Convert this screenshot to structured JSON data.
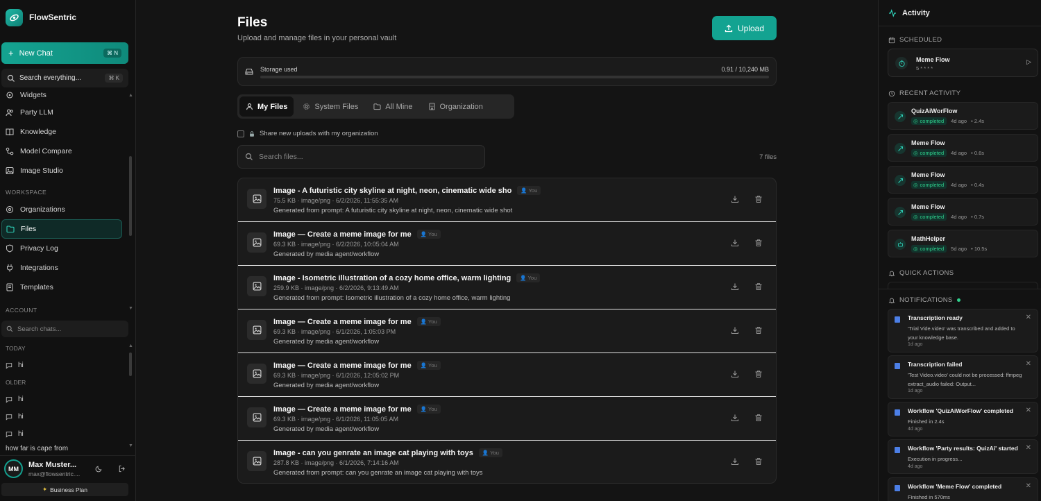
{
  "app": {
    "name": "FlowSentric"
  },
  "sidebar": {
    "new_chat": "New Chat",
    "new_chat_kbd": "⌘ N",
    "search_label": "Search everything...",
    "search_kbd": "⌘ K",
    "items": [
      {
        "label": "Widgets",
        "icon": "widgets-icon"
      },
      {
        "label": "Party LLM",
        "icon": "users-icon"
      },
      {
        "label": "Knowledge",
        "icon": "book-icon"
      },
      {
        "label": "Model Compare",
        "icon": "compare-icon"
      },
      {
        "label": "Image Studio",
        "icon": "image-icon"
      }
    ],
    "workspace_label": "WORKSPACE",
    "workspace_items": [
      {
        "label": "Organizations",
        "icon": "org-icon"
      },
      {
        "label": "Files",
        "icon": "folder-icon"
      },
      {
        "label": "Privacy Log",
        "icon": "shield-icon"
      },
      {
        "label": "Integrations",
        "icon": "plug-icon"
      },
      {
        "label": "Templates",
        "icon": "template-icon"
      }
    ],
    "account_label": "ACCOUNT",
    "chat_search_placeholder": "Search chats...",
    "today_label": "TODAY",
    "today_chats": [
      "hi"
    ],
    "older_label": "OLDER",
    "older_chats": [
      "hi",
      "hi",
      "hi",
      "how far is cape from"
    ],
    "user": {
      "initials": "MM",
      "name": "Max Muster...",
      "email": "max@flowsentric...."
    },
    "plan": "Business Plan"
  },
  "main": {
    "title": "Files",
    "subtitle": "Upload and manage files in your personal vault",
    "upload_label": "Upload",
    "storage_label": "Storage used",
    "storage_value": "0.91 / 10,240 MB",
    "storage_fraction": 0.0001,
    "tabs": [
      {
        "label": "My Files",
        "active": true
      },
      {
        "label": "System Files",
        "active": false
      },
      {
        "label": "All Mine",
        "active": false
      },
      {
        "label": "Organization",
        "active": false
      }
    ],
    "share_label": "Share new uploads with my organization",
    "search_placeholder": "Search files...",
    "file_count": "7 files",
    "you_badge": "You",
    "files": [
      {
        "title": "Image - A futuristic city skyline at night, neon, cinematic wide sho",
        "meta": "75.5 KB · image/png · 6/2/2026, 11:55:35 AM",
        "desc": "Generated from prompt: A futuristic city skyline at night, neon, cinematic wide shot"
      },
      {
        "title": "Image — Create a meme image for me",
        "meta": "69.3 KB · image/png · 6/2/2026, 10:05:04 AM",
        "desc": "Generated by media agent/workflow"
      },
      {
        "title": "Image - Isometric illustration of a cozy home office, warm lighting",
        "meta": "259.9 KB · image/png · 6/2/2026, 9:13:49 AM",
        "desc": "Generated from prompt: Isometric illustration of a cozy home office, warm lighting"
      },
      {
        "title": "Image — Create a meme image for me",
        "meta": "69.3 KB · image/png · 6/1/2026, 1:05:03 PM",
        "desc": "Generated by media agent/workflow"
      },
      {
        "title": "Image — Create a meme image for me",
        "meta": "69.3 KB · image/png · 6/1/2026, 12:05:02 PM",
        "desc": "Generated by media agent/workflow"
      },
      {
        "title": "Image — Create a meme image for me",
        "meta": "69.3 KB · image/png · 6/1/2026, 11:05:05 AM",
        "desc": "Generated by media agent/workflow"
      },
      {
        "title": "Image - can you genrate an image cat playing with toys",
        "meta": "287.8 KB · image/png · 6/1/2026, 7:14:16 AM",
        "desc": "Generated from prompt: can you genrate an image cat playing with toys"
      }
    ]
  },
  "activity": {
    "title": "Activity",
    "scheduled_label": "SCHEDULED",
    "scheduled": {
      "name": "Meme Flow",
      "cron": "5 * * * *"
    },
    "recent_label": "RECENT ACTIVITY",
    "recent": [
      {
        "name": "QuizAiWorFlow",
        "status": "completed",
        "ago": "4d ago",
        "dur": "• 2.4s"
      },
      {
        "name": "Meme Flow",
        "status": "completed",
        "ago": "4d ago",
        "dur": "• 0.6s"
      },
      {
        "name": "Meme Flow",
        "status": "completed",
        "ago": "4d ago",
        "dur": "• 0.4s"
      },
      {
        "name": "Meme Flow",
        "status": "completed",
        "ago": "4d ago",
        "dur": "• 0.7s"
      },
      {
        "name": "MathHelper",
        "status": "completed",
        "ago": "5d ago",
        "dur": "• 10.5s"
      }
    ],
    "quick_label": "QUICK ACTIONS",
    "notifications_label": "NOTIFICATIONS",
    "notifications": [
      {
        "title": "Transcription ready",
        "body": "'Trial Vide.video' was transcribed and added to your knowledge base.",
        "time": "1d ago"
      },
      {
        "title": "Transcription failed",
        "body": "'Test Video.video' could not be processed: ffmpeg extract_audio failed: Output...",
        "time": "1d ago"
      },
      {
        "title": "Workflow 'QuizAiWorFlow' completed",
        "body": "Finished in 2.4s",
        "time": "4d ago"
      },
      {
        "title": "Workflow 'Party results: QuizAi' started",
        "body": "Execution in progress...",
        "time": "4d ago"
      },
      {
        "title": "Workflow 'Meme Flow' completed",
        "body": "Finished in 570ms",
        "time": ""
      }
    ]
  }
}
